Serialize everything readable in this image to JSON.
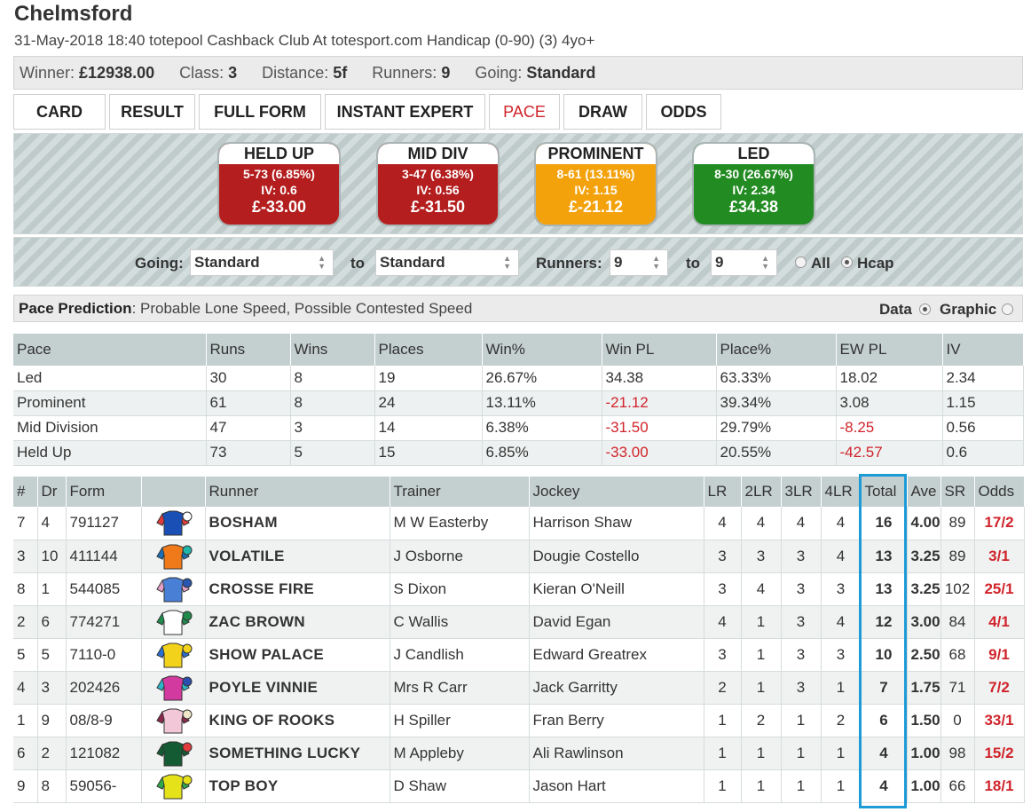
{
  "header": {
    "course": "Chelmsford",
    "race_line": "31-May-2018 18:40 totepool Cashback Club At totesport.com Handicap (0-90) (3) 4yo+"
  },
  "info": {
    "winner_label": "Winner:",
    "winner_value": "£12938.00",
    "class_label": "Class:",
    "class_value": "3",
    "distance_label": "Distance:",
    "distance_value": "5f",
    "runners_label": "Runners:",
    "runners_value": "9",
    "going_label": "Going:",
    "going_value": "Standard"
  },
  "tabs": [
    "CARD",
    "RESULT",
    "FULL FORM",
    "INSTANT EXPERT",
    "PACE",
    "DRAW",
    "ODDS"
  ],
  "active_tab": "PACE",
  "pace_boxes": [
    {
      "title": "HELD UP",
      "line1": "5-73 (6.85%)",
      "line2": "IV: 0.6",
      "pl": "£-33.00",
      "color": "#b41e1e"
    },
    {
      "title": "MID DIV",
      "line1": "3-47 (6.38%)",
      "line2": "IV: 0.56",
      "pl": "£-31.50",
      "color": "#b41e1e"
    },
    {
      "title": "PROMINENT",
      "line1": "8-61 (13.11%)",
      "line2": "IV: 1.15",
      "pl": "£-21.12",
      "color": "#f3a20c"
    },
    {
      "title": "LED",
      "line1": "8-30 (26.67%)",
      "line2": "IV: 2.34",
      "pl": "£34.38",
      "color": "#228b22"
    }
  ],
  "filters": {
    "going_label": "Going:",
    "going_from": "Standard",
    "to_label": "to",
    "going_to": "Standard",
    "runners_label": "Runners:",
    "runners_from": "9",
    "to_label2": "to",
    "runners_to": "9",
    "all_label": "All",
    "hcap_label": "Hcap"
  },
  "prediction": {
    "label": "Pace Prediction",
    "text": ": Probable Lone Speed, Possible Contested Speed",
    "data_label": "Data",
    "graphic_label": "Graphic"
  },
  "pace_table": {
    "headers": [
      "Pace",
      "Runs",
      "Wins",
      "Places",
      "Win%",
      "Win PL",
      "Place%",
      "EW PL",
      "IV"
    ],
    "rows": [
      [
        "Led",
        "30",
        "8",
        "19",
        "26.67%",
        "34.38",
        "63.33%",
        "18.02",
        "2.34"
      ],
      [
        "Prominent",
        "61",
        "8",
        "24",
        "13.11%",
        "-21.12",
        "39.34%",
        "3.08",
        "1.15"
      ],
      [
        "Mid Division",
        "47",
        "3",
        "14",
        "6.38%",
        "-31.50",
        "29.79%",
        "-8.25",
        "0.56"
      ],
      [
        "Held Up",
        "73",
        "5",
        "15",
        "6.85%",
        "-33.00",
        "20.55%",
        "-42.57",
        "0.6"
      ]
    ]
  },
  "runners_table": {
    "headers": [
      "#",
      "Dr",
      "Form",
      "",
      "Runner",
      "Trainer",
      "Jockey",
      "LR",
      "2LR",
      "3LR",
      "4LR",
      "Total",
      "Ave",
      "SR",
      "Odds"
    ],
    "rows": [
      {
        "num": "7",
        "dr": "4",
        "form": "791127",
        "runner": "BOSHAM",
        "trainer": "M W Easterby",
        "jockey": "Harrison Shaw",
        "lr": "4",
        "lr2": "4",
        "lr3": "4",
        "lr4": "4",
        "total": "16",
        "ave": "4.00",
        "sr": "89",
        "odds": "17/2",
        "silk": [
          "#1a4fb5",
          "#e23b3b",
          "#ffffff"
        ]
      },
      {
        "num": "3",
        "dr": "10",
        "form": "411144",
        "runner": "VOLATILE",
        "trainer": "J Osborne",
        "jockey": "Dougie Costello",
        "lr": "3",
        "lr2": "3",
        "lr3": "3",
        "lr4": "4",
        "total": "13",
        "ave": "3.25",
        "sr": "89",
        "odds": "3/1",
        "silk": [
          "#f07a1a",
          "#1a6fb5",
          "#1fb5a8"
        ]
      },
      {
        "num": "8",
        "dr": "1",
        "form": "544085",
        "runner": "CROSSE FIRE",
        "trainer": "S Dixon",
        "jockey": "Kieran O'Neill",
        "lr": "3",
        "lr2": "4",
        "lr3": "3",
        "lr4": "3",
        "total": "13",
        "ave": "3.25",
        "sr": "102",
        "odds": "25/1",
        "silk": [
          "#4a7fd6",
          "#e6a0c8",
          "#2a55b0"
        ]
      },
      {
        "num": "2",
        "dr": "6",
        "form": "774271",
        "runner": "ZAC BROWN",
        "trainer": "C Wallis",
        "jockey": "David Egan",
        "lr": "4",
        "lr2": "1",
        "lr3": "3",
        "lr4": "4",
        "total": "12",
        "ave": "3.00",
        "sr": "84",
        "odds": "4/1",
        "silk": [
          "#ffffff",
          "#1f8a4c",
          "#1f8a4c"
        ]
      },
      {
        "num": "5",
        "dr": "5",
        "form": "7110-0",
        "runner": "SHOW PALACE",
        "trainer": "J Candlish",
        "jockey": "Edward Greatrex",
        "lr": "3",
        "lr2": "1",
        "lr3": "3",
        "lr4": "3",
        "total": "10",
        "ave": "2.50",
        "sr": "68",
        "odds": "9/1",
        "silk": [
          "#f2d21a",
          "#2a6fd0",
          "#f2d21a"
        ]
      },
      {
        "num": "4",
        "dr": "3",
        "form": "202426",
        "runner": "POYLE VINNIE",
        "trainer": "Mrs R Carr",
        "jockey": "Jack Garritty",
        "lr": "2",
        "lr2": "1",
        "lr3": "3",
        "lr4": "1",
        "total": "7",
        "ave": "1.75",
        "sr": "71",
        "odds": "7/2",
        "silk": [
          "#d23aa0",
          "#2ab8c8",
          "#2a4fb0"
        ]
      },
      {
        "num": "1",
        "dr": "9",
        "form": "08/8-9",
        "runner": "KING OF ROOKS",
        "trainer": "H Spiller",
        "jockey": "Fran Berry",
        "lr": "1",
        "lr2": "2",
        "lr3": "1",
        "lr4": "2",
        "total": "6",
        "ave": "1.50",
        "sr": "0",
        "odds": "33/1",
        "silk": [
          "#f2c8d8",
          "#8a2a4a",
          "#f2e6c8"
        ]
      },
      {
        "num": "6",
        "dr": "2",
        "form": "121082",
        "runner": "SOMETHING LUCKY",
        "trainer": "M Appleby",
        "jockey": "Ali Rawlinson",
        "lr": "1",
        "lr2": "1",
        "lr3": "1",
        "lr4": "1",
        "total": "4",
        "ave": "1.00",
        "sr": "98",
        "odds": "15/2",
        "silk": [
          "#145a32",
          "#145a32",
          "#e23b3b"
        ]
      },
      {
        "num": "9",
        "dr": "8",
        "form": "59056-",
        "runner": "TOP BOY",
        "trainer": "D Shaw",
        "jockey": "Jason Hart",
        "lr": "1",
        "lr2": "1",
        "lr3": "1",
        "lr4": "1",
        "total": "4",
        "ave": "1.00",
        "sr": "66",
        "odds": "18/1",
        "silk": [
          "#e6e21a",
          "#2fa84a",
          "#e6e21a"
        ]
      }
    ]
  }
}
